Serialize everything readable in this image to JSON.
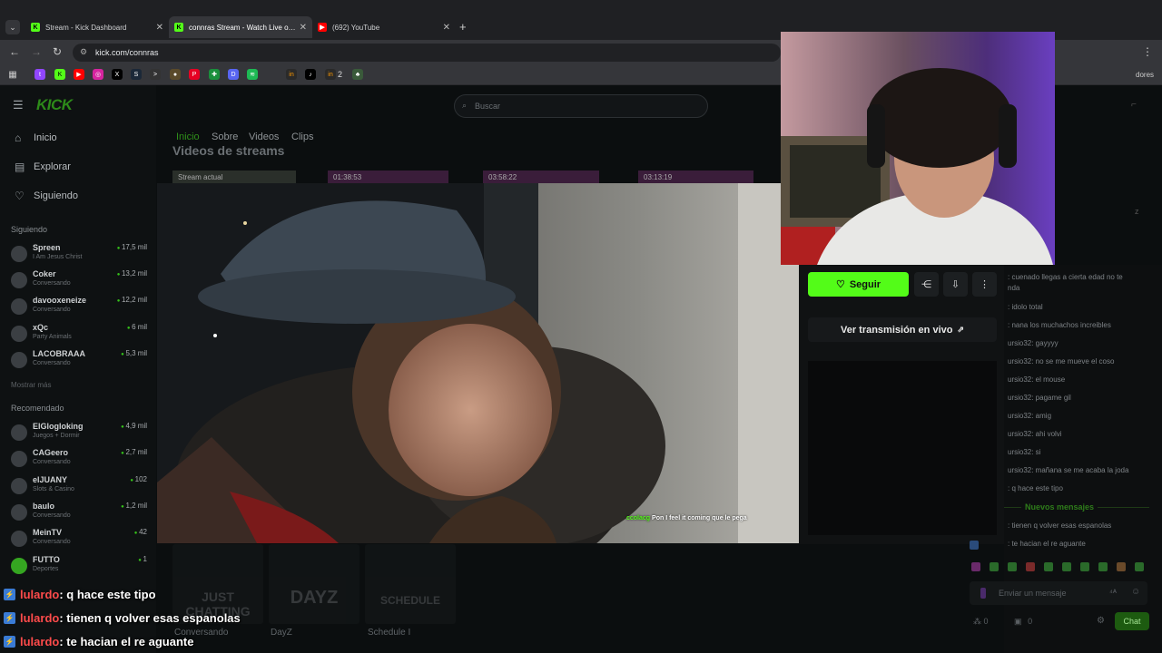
{
  "browser": {
    "tabs": [
      {
        "title": "Stream - Kick Dashboard",
        "icon": "kick-icon",
        "active": false
      },
      {
        "title": "connras Stream - Watch Live on Kick",
        "icon": "kick-icon",
        "active": true
      },
      {
        "title": "(692) YouTube",
        "icon": "youtube-icon",
        "active": false
      }
    ],
    "url": "kick.com/connras",
    "new_tab_label": "+",
    "bookmark_badge_text": "2",
    "right_clip_text": "dores"
  },
  "kick": {
    "logo": "KICK",
    "search_placeholder": "Buscar",
    "nav": [
      "Inicio",
      "Explorar",
      "Siguiendo"
    ],
    "following_title": "Siguiendo",
    "following": [
      {
        "name": "Spreen",
        "sub": "I Am Jesus Christ",
        "viewers": "17,5 mil"
      },
      {
        "name": "Coker",
        "sub": "Conversando",
        "viewers": "13,2 mil"
      },
      {
        "name": "davooxeneize",
        "sub": "Conversando",
        "viewers": "12,2 mil"
      },
      {
        "name": "xQc",
        "sub": "Party Animals",
        "viewers": "6 mil"
      },
      {
        "name": "LACOBRAAA",
        "sub": "Conversando",
        "viewers": "5,3 mil"
      }
    ],
    "show_more": "Mostrar más",
    "recommended_title": "Recomendado",
    "recommended": [
      {
        "name": "ElGlogloking",
        "sub": "Juegos + Dormir",
        "viewers": "4,9 mil"
      },
      {
        "name": "CAGeero",
        "sub": "Conversando",
        "viewers": "2,7 mil"
      },
      {
        "name": "elJUANY",
        "sub": "Slots & Casino",
        "viewers": "102"
      },
      {
        "name": "baulo",
        "sub": "Conversando",
        "viewers": "1,2 mil"
      },
      {
        "name": "MeinTV",
        "sub": "Conversando",
        "viewers": "42"
      },
      {
        "name": "FUTTO",
        "sub": "Deportes",
        "viewers": "1"
      }
    ],
    "profile_tabs": [
      "Inicio",
      "Sobre",
      "Videos",
      "Clips"
    ],
    "section_heading": "Videos de streams",
    "video_thumbs": [
      "Stream actual",
      "01:38:53",
      "03:58:22",
      "03:13:19"
    ],
    "follow_button": "Seguir",
    "watch_live": "Ver transmisión en vivo",
    "categories": [
      {
        "image_text": "JUST CHATTING",
        "label": "Conversando"
      },
      {
        "image_text": "DAYZ",
        "label": "DayZ"
      },
      {
        "image_text": "SCHEDULE",
        "label": "Schedule I"
      }
    ]
  },
  "video": {
    "caption_user": "ccolacg",
    "caption_text": "Pon I feel it coming que le pega"
  },
  "chat": {
    "messages": [
      ": cuenado llegas a cierta edad no te",
      "nda",
      ": idolo total",
      ": nana los muchachos increibles",
      "ursio32: gayyyy",
      "ursio32: no se me mueve el coso",
      "ursio32: el mouse",
      "ursio32: pagame gil",
      "ursio32: amig",
      "ursio32: ahi volvi",
      "ursio32: si",
      "ursio32: mañana se me acaba la joda",
      ": q hace este tipo"
    ],
    "new_messages": "Nuevos mensajes",
    "after": [
      ": tienen q volver esas espanolas",
      ": te hacian el re aguante"
    ],
    "input_placeholder": "Enviar un mensaje",
    "chat_button": "Chat",
    "stat1": "0",
    "stat_other": "0"
  },
  "overlay": [
    {
      "user": "lulardo",
      "text": ": q hace este tipo"
    },
    {
      "user": "lulardo",
      "text": ": tienen q volver esas espanolas"
    },
    {
      "user": "lulardo",
      "text": ": te hacian el re aguante"
    }
  ]
}
